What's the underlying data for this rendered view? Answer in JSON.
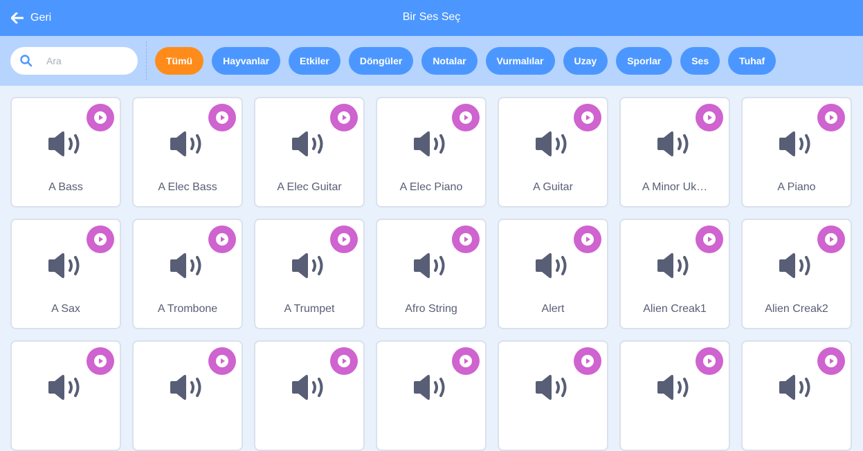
{
  "header": {
    "back_label": "Geri",
    "title": "Bir Ses Seç"
  },
  "search": {
    "placeholder": "Ara",
    "value": ""
  },
  "tags": [
    {
      "label": "Tümü",
      "active": true
    },
    {
      "label": "Hayvanlar",
      "active": false
    },
    {
      "label": "Etkiler",
      "active": false
    },
    {
      "label": "Döngüler",
      "active": false
    },
    {
      "label": "Notalar",
      "active": false
    },
    {
      "label": "Vurmalılar",
      "active": false
    },
    {
      "label": "Uzay",
      "active": false
    },
    {
      "label": "Sporlar",
      "active": false
    },
    {
      "label": "Ses",
      "active": false
    },
    {
      "label": "Tuhaf",
      "active": false
    }
  ],
  "sounds": [
    {
      "name": "A Bass"
    },
    {
      "name": "A Elec Bass"
    },
    {
      "name": "A Elec Guitar"
    },
    {
      "name": "A Elec Piano"
    },
    {
      "name": "A Guitar"
    },
    {
      "name": "A Minor Uk…"
    },
    {
      "name": "A Piano"
    },
    {
      "name": "A Sax"
    },
    {
      "name": "A Trombone"
    },
    {
      "name": "A Trumpet"
    },
    {
      "name": "Afro String"
    },
    {
      "name": "Alert"
    },
    {
      "name": "Alien Creak1"
    },
    {
      "name": "Alien Creak2"
    },
    {
      "name": ""
    },
    {
      "name": ""
    },
    {
      "name": ""
    },
    {
      "name": ""
    },
    {
      "name": ""
    },
    {
      "name": ""
    },
    {
      "name": ""
    }
  ],
  "colors": {
    "header": "#4c97ff",
    "filter_bar": "#b6d4fd",
    "tag_active": "#ff8c1a",
    "tag": "#4c97ff",
    "play_button": "#cf63cf",
    "speaker_icon": "#575e75"
  },
  "icons": {
    "back": "back-arrow-icon",
    "search": "search-icon",
    "play": "play-icon",
    "sound": "speaker-icon"
  }
}
